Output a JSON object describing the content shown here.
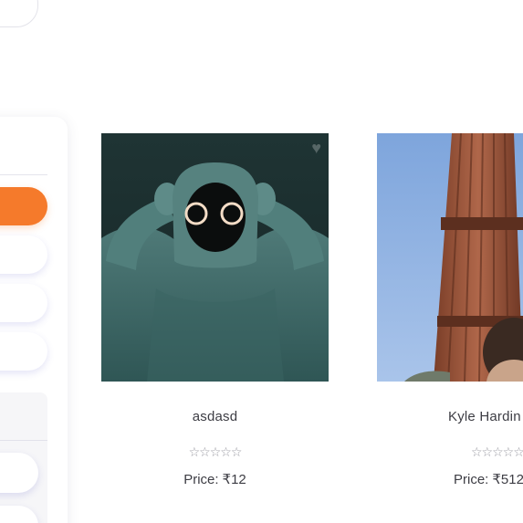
{
  "products": [
    {
      "name": "asdasd",
      "rating": "☆☆☆☆☆",
      "price_label": "Price:",
      "price_value": "₹12",
      "image_icon": "hooded-figure-image"
    },
    {
      "name": "Kyle Hardin",
      "rating": "☆☆☆☆☆",
      "price_label": "Price:",
      "price_value": "₹512",
      "image_icon": "minaret-tower-image"
    }
  ],
  "colors": {
    "accent": "#f57a2b",
    "text": "#3d3d44",
    "star": "#9a9aa2"
  }
}
